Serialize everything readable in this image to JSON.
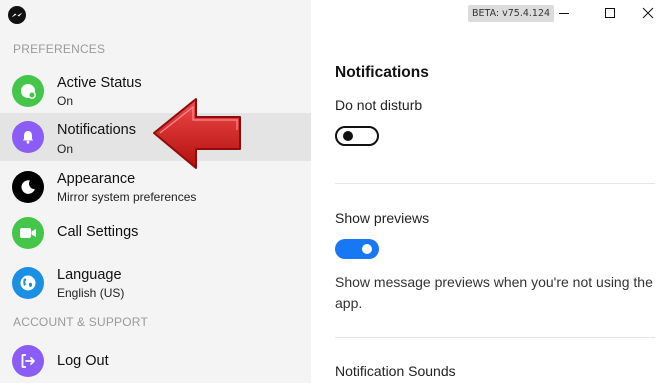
{
  "titlebar": {
    "version_badge": "BETA: v75.4.124"
  },
  "sidebar": {
    "preferences_header": "PREFERENCES",
    "account_header": "ACCOUNT & SUPPORT",
    "items": [
      {
        "title": "Active Status",
        "subtitle": "On",
        "icon": "active-status-icon",
        "color": "#44c64a"
      },
      {
        "title": "Notifications",
        "subtitle": "On",
        "icon": "bell-icon",
        "color": "#8b5cf6"
      },
      {
        "title": "Appearance",
        "subtitle": "Mirror system preferences",
        "icon": "moon-icon",
        "color": "#000000"
      },
      {
        "title": "Call Settings",
        "icon": "video-camera-icon",
        "color": "#44c64a"
      },
      {
        "title": "Language",
        "subtitle": "English (US)",
        "icon": "globe-icon",
        "color": "#1a8fe3"
      },
      {
        "title": "Log Out",
        "icon": "logout-icon",
        "color": "#8b5cf6"
      }
    ]
  },
  "main": {
    "title": "Notifications",
    "do_not_disturb": {
      "label": "Do not disturb",
      "enabled": false
    },
    "show_previews": {
      "label": "Show previews",
      "enabled": true,
      "description": "Show message previews when you're not using the app."
    },
    "notification_sounds_label": "Notification Sounds"
  },
  "colors": {
    "accent": "#1877f2",
    "annotation_arrow": "#d81f1f"
  }
}
